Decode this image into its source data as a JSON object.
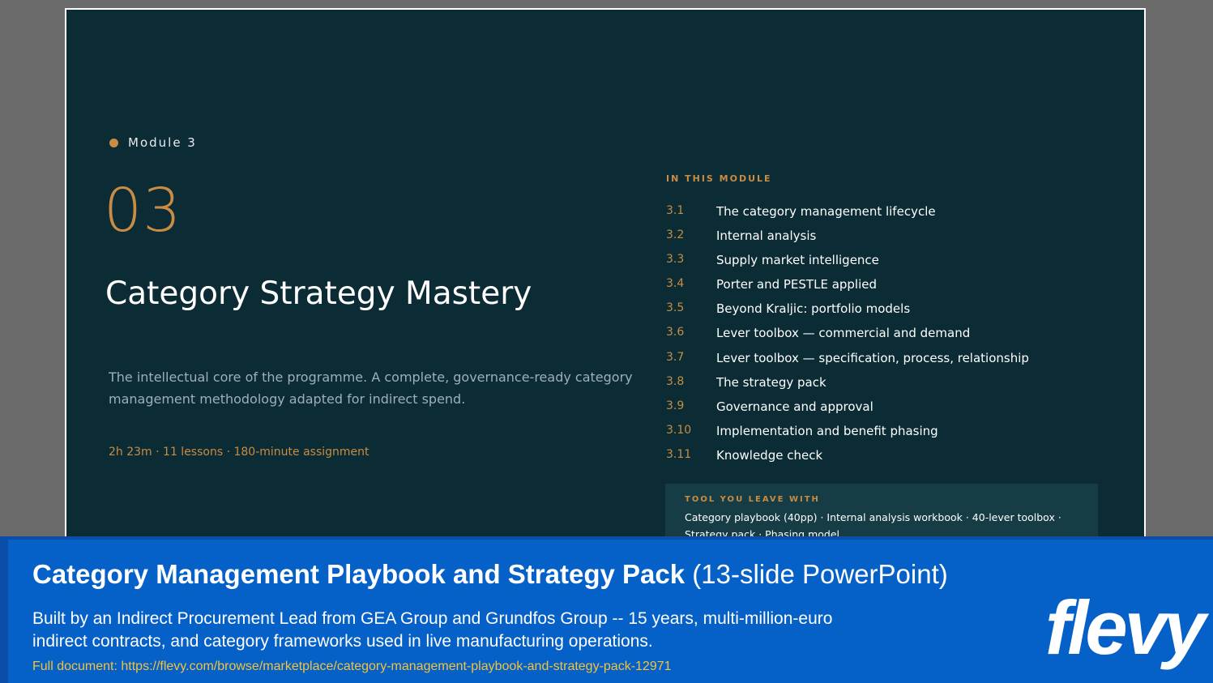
{
  "slide": {
    "module_label": "Module 3",
    "module_number": "03",
    "title": "Category Strategy Mastery",
    "description": "The intellectual core of the programme. A complete, governance-ready category management methodology adapted for indirect spend.",
    "meta": "2h 23m · 11 lessons · 180-minute assignment",
    "in_module_heading": "IN THIS MODULE",
    "lessons": [
      {
        "num": "3.1",
        "title": "The category management lifecycle"
      },
      {
        "num": "3.2",
        "title": "Internal analysis"
      },
      {
        "num": "3.3",
        "title": "Supply market intelligence"
      },
      {
        "num": "3.4",
        "title": "Porter and PESTLE applied"
      },
      {
        "num": "3.5",
        "title": "Beyond Kraljic: portfolio models"
      },
      {
        "num": "3.6",
        "title": "Lever toolbox — commercial and demand"
      },
      {
        "num": "3.7",
        "title": "Lever toolbox — specification, process, relationship"
      },
      {
        "num": "3.8",
        "title": "The strategy pack"
      },
      {
        "num": "3.9",
        "title": "Governance and approval"
      },
      {
        "num": "3.10",
        "title": "Implementation and benefit phasing"
      },
      {
        "num": "3.11",
        "title": "Knowledge check"
      }
    ],
    "tool_heading": "TOOL YOU LEAVE WITH",
    "tool_text": "Category playbook (40pp) ·  Internal analysis workbook · 40-lever toolbox · Strategy pack · Phasing model"
  },
  "banner": {
    "title_bold": "Category Management Playbook and Strategy Pack",
    "title_light": "(13-slide PowerPoint)",
    "description": "Built by an Indirect Procurement Lead from GEA Group and Grundfos Group -- 15 years, multi-million-euro indirect contracts, and category frameworks used in live manufacturing operations.",
    "link": "Full document: https://flevy.com/browse/marketplace/category-management-playbook-and-strategy-pack-12971",
    "logo": "flevy"
  },
  "colors": {
    "slide_bg": "#0b2b35",
    "accent": "#c98c43",
    "banner_bg": "#0560c7",
    "link": "#f3c33b"
  }
}
